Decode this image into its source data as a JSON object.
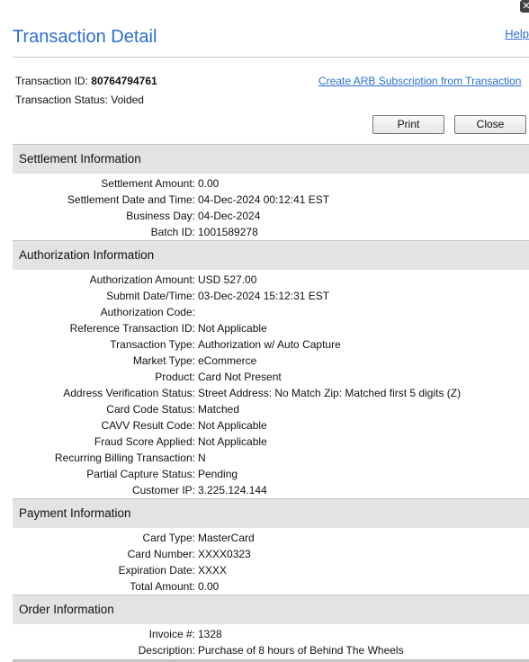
{
  "window": {
    "close_glyph": "✕"
  },
  "header": {
    "title": "Transaction Detail",
    "help_label": "Help"
  },
  "transaction": {
    "id_label": "Transaction ID:",
    "id_value": "80764794761",
    "status_label": "Transaction Status:",
    "status_value": "Voided",
    "arb_link": "Create ARB Subscription from Transaction"
  },
  "buttons": {
    "print": "Print",
    "close": "Close"
  },
  "settlement": {
    "title": "Settlement Information",
    "rows": [
      {
        "label": "Settlement Amount:",
        "value": "0.00"
      },
      {
        "label": "Settlement Date and Time:",
        "value": "04-Dec-2024 00:12:41 EST"
      },
      {
        "label": "Business Day:",
        "value": "04-Dec-2024"
      },
      {
        "label": "Batch ID:",
        "value": "1001589278"
      }
    ]
  },
  "authorization": {
    "title": "Authorization Information",
    "rows": [
      {
        "label": "Authorization Amount:",
        "value": "USD 527.00"
      },
      {
        "label": "Submit Date/Time:",
        "value": "03-Dec-2024 15:12:31 EST"
      },
      {
        "label": "Authorization Code:",
        "value": ""
      },
      {
        "label": "Reference Transaction ID:",
        "value": "Not Applicable"
      },
      {
        "label": "Transaction Type:",
        "value": "Authorization w/ Auto Capture"
      },
      {
        "label": "Market Type:",
        "value": "eCommerce"
      },
      {
        "label": "Product:",
        "value": "Card Not Present"
      },
      {
        "label": "Address Verification Status:",
        "value": "Street Address: No Match Zip: Matched first 5 digits (Z)"
      },
      {
        "label": "Card Code Status:",
        "value": "Matched"
      },
      {
        "label": "CAVV Result Code:",
        "value": "Not Applicable"
      },
      {
        "label": "Fraud Score Applied:",
        "value": "Not Applicable"
      },
      {
        "label": "Recurring Billing Transaction:",
        "value": "N"
      },
      {
        "label": "Partial Capture Status:",
        "value": "Pending"
      },
      {
        "label": "Customer IP:",
        "value": "3.225.124.144"
      }
    ]
  },
  "payment": {
    "title": "Payment Information",
    "rows": [
      {
        "label": "Card Type:",
        "value": "MasterCard"
      },
      {
        "label": "Card Number:",
        "value": "XXXX0323"
      },
      {
        "label": "Expiration Date:",
        "value": "XXXX"
      },
      {
        "label": "Total Amount:",
        "value": "0.00"
      }
    ]
  },
  "order": {
    "title": "Order Information",
    "rows": [
      {
        "label": "Invoice #:",
        "value": "1328"
      },
      {
        "label": "Description:",
        "value": "Purchase of 8 hours of Behind The Wheels"
      }
    ]
  }
}
